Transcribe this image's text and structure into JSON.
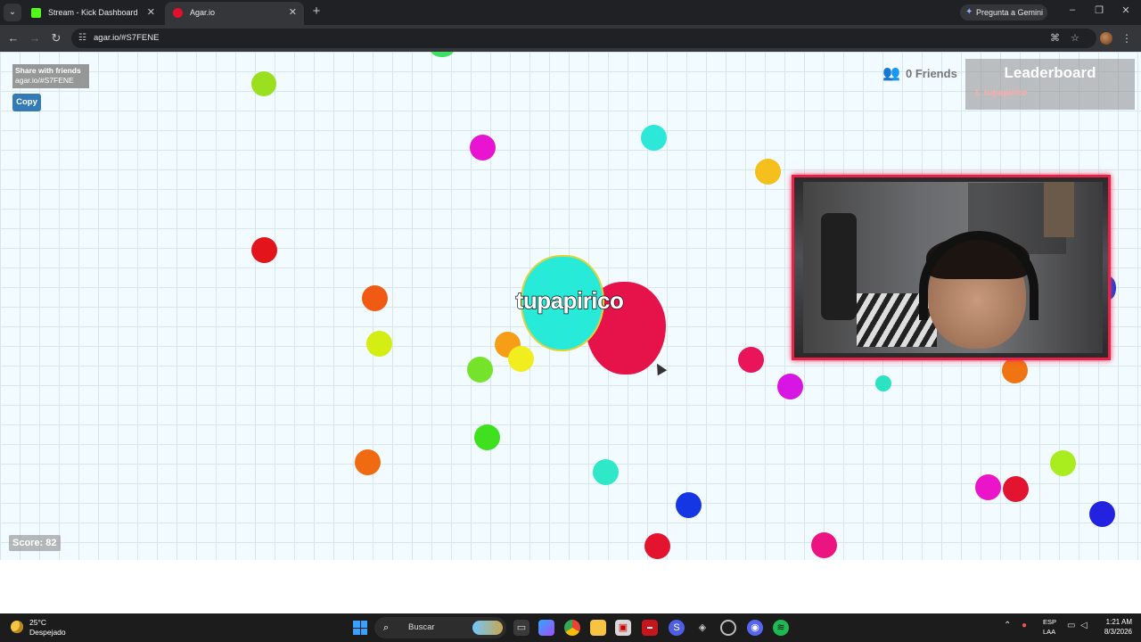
{
  "browser": {
    "tabs": [
      {
        "title": "Stream - Kick Dashboard",
        "favicon_color": "#53fc18"
      },
      {
        "title": "Agar.io",
        "favicon_color": "#e0102e"
      }
    ],
    "gemini_label": "Pregunta a Gemini",
    "url": "agar.io/#S7FENE"
  },
  "game": {
    "share_title": "Share with friends",
    "share_link": "agar.io/#S7FENE",
    "copy_label": "Copy",
    "friends_label": "0 Friends",
    "leaderboard_title": "Leaderboard",
    "leaderboard_entries": [
      "1. tupapirico"
    ],
    "score_label": "Score: 82",
    "player_name": "tupapirico",
    "colors": {
      "background": "#f2fbff",
      "grid": "#d9e6ec",
      "cell_cyan": "#27ead8",
      "cell_red": "#e6124a",
      "webcam_border": "#e8234a"
    }
  },
  "taskbar": {
    "temperature": "25°C",
    "condition": "Despejado",
    "search_label": "Buscar",
    "lang_top": "ESP",
    "lang_bottom": "LAA",
    "time": "1:21 AM",
    "date": "8/3/2026"
  }
}
